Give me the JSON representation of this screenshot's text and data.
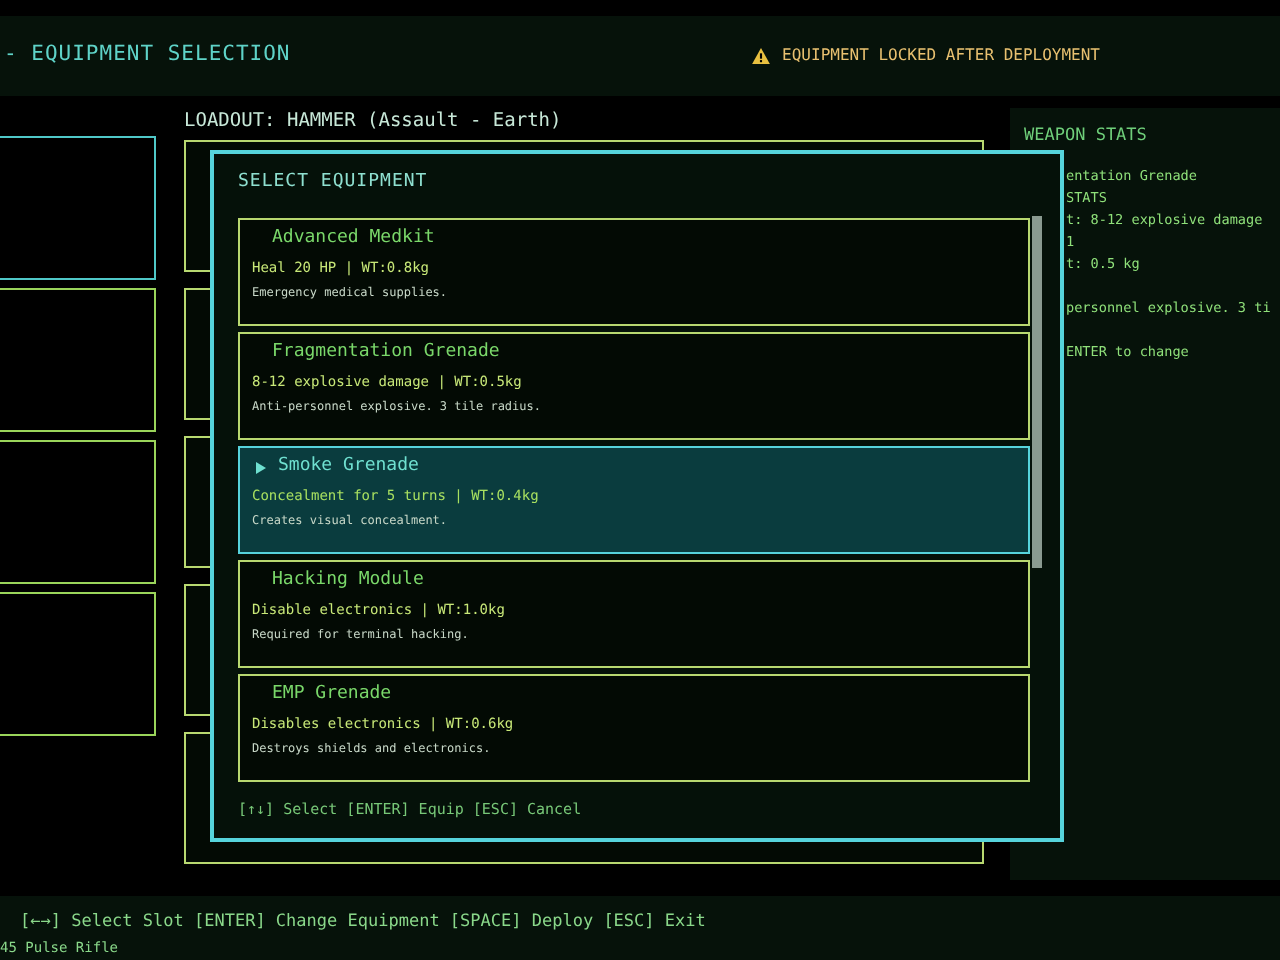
{
  "header": {
    "title": "- EQUIPMENT SELECTION",
    "warning": "EQUIPMENT LOCKED AFTER DEPLOYMENT"
  },
  "loadout": {
    "label": "LOADOUT: HAMMER (Assault - Earth)"
  },
  "weapon_stats": {
    "title": "WEAPON STATS",
    "line_groups": [
      [
        "entation Grenade",
        "STATS",
        "t: 8-12 explosive damage",
        "1",
        "t: 0.5 kg"
      ],
      [
        "personnel explosive. 3 ti"
      ],
      [
        "ENTER to change"
      ]
    ]
  },
  "dialog": {
    "title": "SELECT EQUIPMENT",
    "items": [
      {
        "name": "Advanced Medkit",
        "stats": "Heal 20 HP | WT:0.8kg",
        "description": "Emergency medical supplies.",
        "selected": false
      },
      {
        "name": "Fragmentation Grenade",
        "stats": "8-12 explosive damage | WT:0.5kg",
        "description": "Anti-personnel explosive. 3 tile radius.",
        "selected": false
      },
      {
        "name": "Smoke Grenade",
        "stats": "Concealment for 5 turns | WT:0.4kg",
        "description": "Creates visual concealment.",
        "selected": true
      },
      {
        "name": "Hacking Module",
        "stats": "Disable electronics | WT:1.0kg",
        "description": "Required for terminal hacking.",
        "selected": false
      },
      {
        "name": "EMP Grenade",
        "stats": "Disables electronics | WT:0.6kg",
        "description": "Destroys shields and electronics.",
        "selected": false
      }
    ],
    "hints": "[↑↓] Select  [ENTER] Equip  [ESC] Cancel"
  },
  "footer": {
    "hints": "[←→] Select Slot  [ENTER] Change Equipment  [SPACE] Deploy  [ESC] Exit",
    "status": "45 Pulse Rifle"
  }
}
